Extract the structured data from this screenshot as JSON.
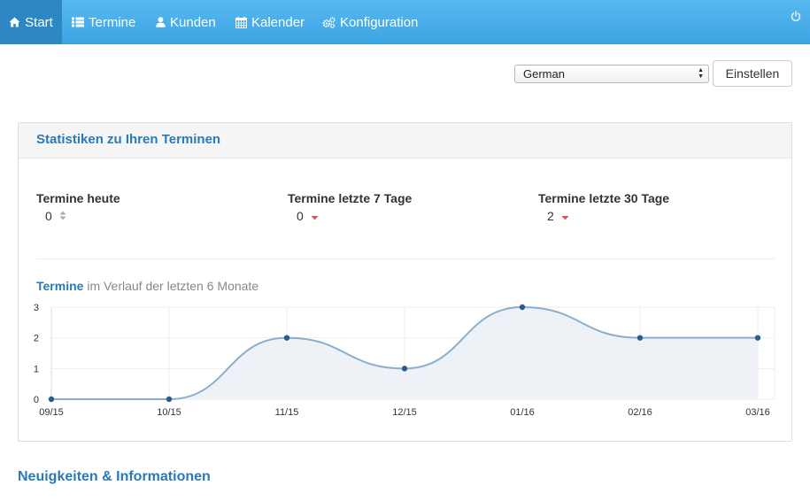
{
  "nav": {
    "items": [
      {
        "label": "Start",
        "icon": "home-icon"
      },
      {
        "label": "Termine",
        "icon": "list-icon"
      },
      {
        "label": "Kunden",
        "icon": "user-icon"
      },
      {
        "label": "Kalender",
        "icon": "calendar-icon"
      },
      {
        "label": "Konfiguration",
        "icon": "cogs-icon"
      }
    ],
    "power_icon": "power-icon"
  },
  "language": {
    "selected": "German",
    "button_label": "Einstellen"
  },
  "stats": {
    "title": "Statistiken zu Ihren Terminen",
    "today": {
      "label": "Termine heute",
      "value": "0",
      "trend_icon": "sort-icon"
    },
    "week": {
      "label": "Termine letzte 7 Tage",
      "value": "0",
      "trend_icon": "caret-down-icon"
    },
    "month": {
      "label": "Termine letzte 30 Tage",
      "value": "2",
      "trend_icon": "caret-down-icon"
    }
  },
  "chart_title": {
    "strong": "Termine",
    "sub": " im Verlauf der letzten 6 Monate"
  },
  "chart_data": {
    "type": "area",
    "categories": [
      "09/15",
      "10/15",
      "11/15",
      "12/15",
      "01/16",
      "02/16",
      "03/16"
    ],
    "values": [
      0,
      0,
      2,
      1,
      3,
      2,
      2
    ],
    "y_ticks": [
      "0",
      "1",
      "2",
      "3"
    ],
    "ylim": [
      0,
      3
    ],
    "grid": true,
    "colors": {
      "line": "#8aaed0",
      "fill": "#eef1f6",
      "point": "#2b5c8f",
      "grid": "#eeeeee"
    }
  },
  "news": {
    "title": "Neuigkeiten & Informationen"
  }
}
